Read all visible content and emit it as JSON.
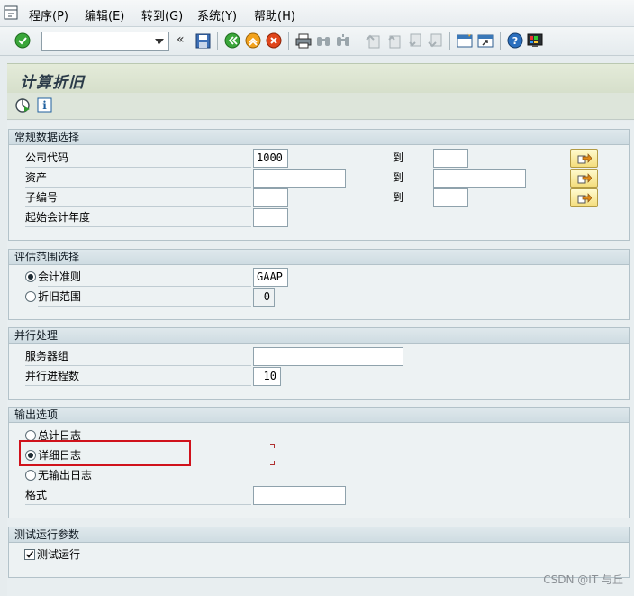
{
  "menu": {
    "items": [
      "程序(P)",
      "编辑(E)",
      "转到(G)",
      "系统(Y)",
      "帮助(H)"
    ]
  },
  "toolbar": {
    "command_value": "",
    "back_glyph": "«"
  },
  "screen": {
    "title": "计算折旧"
  },
  "groups": {
    "general": {
      "title": "常规数据选择",
      "company_code_label": "公司代码",
      "company_code_value": "1000",
      "asset_label": "资产",
      "subnumber_label": "子编号",
      "fiscal_year_label": "起始会计年度",
      "to_label": "到"
    },
    "valuation": {
      "title": "评估范围选择",
      "accounting_principle_label": "会计准则",
      "accounting_principle_value": "GAAP",
      "depreciation_area_label": "折旧范围",
      "depreciation_area_value": "0"
    },
    "parallel": {
      "title": "并行处理",
      "server_group_label": "服务器组",
      "server_group_value": "",
      "process_count_label": "并行进程数",
      "process_count_value": "10"
    },
    "output": {
      "title": "输出选项",
      "summary_log_label": "总计日志",
      "detail_log_label": "详细日志",
      "no_log_label": "无输出日志",
      "format_label": "格式",
      "selected": "detail_log"
    },
    "test": {
      "title": "测试运行参数",
      "test_run_label": "测试运行",
      "test_run_checked": true
    }
  },
  "watermark": "CSDN @IT 与丘",
  "colors": {
    "highlight": "#d0121b",
    "execute_green": "#2e9a2e",
    "multi_button_yellow": "#f4dd7c"
  }
}
